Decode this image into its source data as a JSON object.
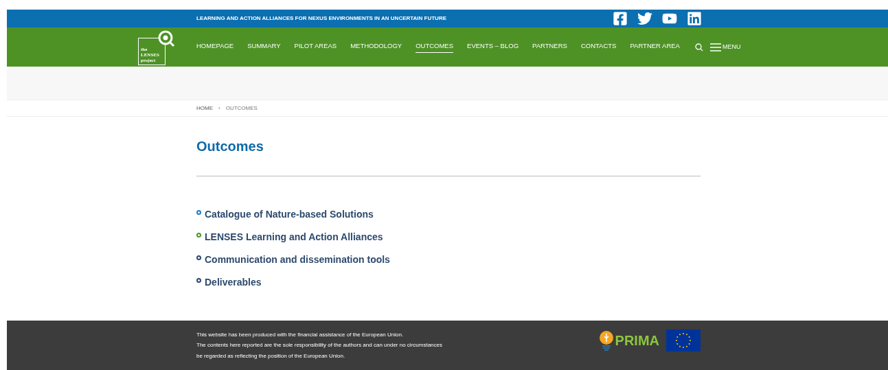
{
  "top_bar": {
    "tagline": "LEARNING AND ACTION ALLIANCES FOR NEXUS ENVIRONMENTS IN AN UNCERTAIN FUTURE",
    "social": [
      {
        "kind": "facebook"
      },
      {
        "kind": "twitter"
      },
      {
        "kind": "youtube"
      },
      {
        "kind": "linkedin"
      }
    ]
  },
  "logo": {
    "lines": [
      "the",
      "LENSES",
      "project"
    ]
  },
  "nav": {
    "items": [
      {
        "label": "HOMEPAGE",
        "selected": false
      },
      {
        "label": "SUMMARY",
        "selected": false
      },
      {
        "label": "PILOT AREAS",
        "selected": false
      },
      {
        "label": "METHODOLOGY",
        "selected": false
      },
      {
        "label": "OUTCOMES",
        "selected": true
      },
      {
        "label": "EVENTS – BLOG",
        "selected": false
      },
      {
        "label": "PARTNERS",
        "selected": false
      },
      {
        "label": "CONTACTS",
        "selected": false
      },
      {
        "label": "PARTNER AREA",
        "selected": false
      }
    ],
    "menu_label": "MENU"
  },
  "breadcrumb": [
    "HOME",
    "›",
    "OUTCOMES"
  ],
  "page_title": "Outcomes",
  "links": [
    {
      "label": "Catalogue of Nature-based Solutions",
      "color": "#1f7fc0"
    },
    {
      "label": "LENSES Learning and Action Alliances",
      "color": "#4a9a2a"
    },
    {
      "label": "Communication and dissemination tools",
      "color": "#2d4a6e"
    },
    {
      "label": "Deliverables",
      "color": "#2d4a6e"
    }
  ],
  "footer": {
    "lines": [
      "This website has been produced with the financial assistance of the European Union.",
      "The contents here reported are the sole responsibility of the authors and can under no circumstances",
      "be regarded as reflecting the position of the European Union."
    ],
    "prima_label": "PRIMA"
  }
}
